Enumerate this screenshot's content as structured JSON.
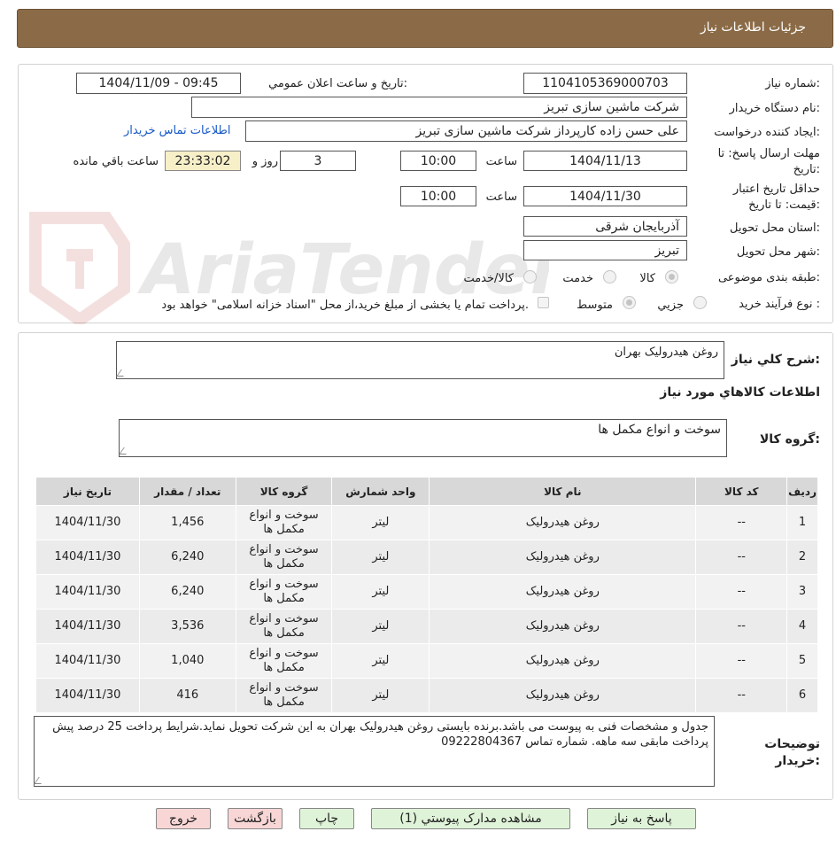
{
  "header": {
    "title": "جزئیات اطلاعات نیاز"
  },
  "form": {
    "need_number_label": "شماره نیاز:",
    "need_number": "1104105369000703",
    "announce_label": "تاریخ و ساعت اعلان عمومي:",
    "announce_value": "1404/11/09 - 09:45",
    "buyer_org_label": "نام دستگاه خریدار:",
    "buyer_org": "شرکت ماشین سازی تبریز",
    "requester_label": "ایجاد کننده درخواست:",
    "requester": "علی حسن زاده کارپرداز شرکت ماشین سازی تبریز",
    "contact_link": "اطلاعات تماس خریدار",
    "deadline_label_1": "مهلت ارسال پاسخ: تا",
    "deadline_label_2": "تاریخ:",
    "deadline_date": "1404/11/13",
    "time_label": "ساعت",
    "deadline_time": "10:00",
    "days_value": "3",
    "days_label": "روز و",
    "remaining_time": "23:33:02",
    "remaining_label": "ساعت باقي مانده",
    "validity_label_1": "حداقل تاریخ اعتبار",
    "validity_label_2": "قیمت: تا تاریخ:",
    "validity_date": "1404/11/30",
    "validity_time": "10:00",
    "province_label": "استان محل تحویل:",
    "province": "آذربایجان شرقی",
    "city_label": "شهر محل تحویل:",
    "city": "تبریز",
    "category_label": "طبقه بندی موضوعی:",
    "category_options": [
      "کالا",
      "خدمت",
      "کالا/خدمت"
    ],
    "process_label": "نوع فرآیند خرید :",
    "process_options": [
      "جزیي",
      "متوسط"
    ],
    "payment_note": "پرداخت تمام یا بخشی از مبلغ خرید،از محل \"اسناد خزانه اسلامی\" خواهد بود."
  },
  "description": {
    "label": "شرح کلي نیاز:",
    "value": "روغن هیدرولیک بهران",
    "items_title": "اطلاعات كالاهاي مورد نیاز",
    "group_label": "گروه کالا:",
    "group_value": "سوخت و انواع مکمل ها"
  },
  "table": {
    "headers": [
      "ردیف",
      "کد کالا",
      "نام کالا",
      "واحد شمارش",
      "گروه کالا",
      "تعداد / مقدار",
      "تاریخ نیاز"
    ],
    "rows": [
      [
        "1",
        "--",
        "روغن هیدرولیک",
        "لیتر",
        "سوخت و انواع مکمل ها",
        "1,456",
        "1404/11/30"
      ],
      [
        "2",
        "--",
        "روغن هیدرولیک",
        "لیتر",
        "سوخت و انواع مکمل ها",
        "6,240",
        "1404/11/30"
      ],
      [
        "3",
        "--",
        "روغن هیدرولیک",
        "لیتر",
        "سوخت و انواع مکمل ها",
        "6,240",
        "1404/11/30"
      ],
      [
        "4",
        "--",
        "روغن هیدرولیک",
        "لیتر",
        "سوخت و انواع مکمل ها",
        "3,536",
        "1404/11/30"
      ],
      [
        "5",
        "--",
        "روغن هیدرولیک",
        "لیتر",
        "سوخت و انواع مکمل ها",
        "1,040",
        "1404/11/30"
      ],
      [
        "6",
        "--",
        "روغن هیدرولیک",
        "لیتر",
        "سوخت و انواع مکمل ها",
        "416",
        "1404/11/30"
      ]
    ]
  },
  "notes": {
    "label_1": "توضیحات",
    "label_2": "خریدار:",
    "value": "جدول و مشخصات فنی به پیوست می باشد.برنده بایستی روغن هیدرولیک بهران به این شرکت تحویل نماید.شرایط پرداخت 25 درصد پیش پرداخت مابقی سه ماهه. شماره تماس 09222804367"
  },
  "buttons": {
    "reply": "پاسخ به نیاز",
    "attachments": "مشاهده مدارک پیوستي (1)",
    "print": "چاپ",
    "back": "بازگشت",
    "exit": "خروج"
  },
  "watermark": {
    "text": "AriaTender.neT"
  },
  "colors": {
    "header": "#8b6b47",
    "link": "#1558c7",
    "highlight": "#f6efc8"
  }
}
